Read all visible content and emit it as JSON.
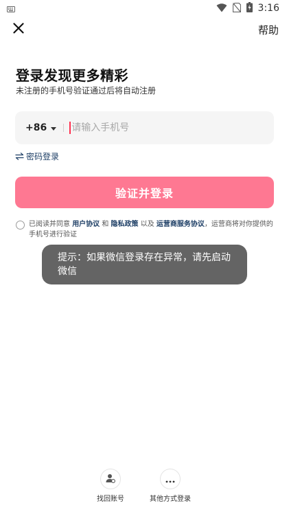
{
  "status_bar": {
    "time": "3:16",
    "icons": [
      "keyboard-icon",
      "wifi-icon",
      "no-sim-icon",
      "battery-charging-icon"
    ]
  },
  "top_bar": {
    "close_icon": "close-icon",
    "help_label": "帮助"
  },
  "title": "登录发现更多精彩",
  "subtitle": "未注册的手机号验证通过后将自动注册",
  "phone": {
    "country_code": "+86",
    "placeholder": "请输入手机号",
    "value": ""
  },
  "password_login": {
    "icon": "swap-arrows-icon",
    "label": "密码登录"
  },
  "verify_button": "验证并登录",
  "agreement": {
    "prefix": "已阅读并同意 ",
    "user_agreement": "用户协议",
    "and1": " 和 ",
    "privacy_policy": "隐私政策",
    "and2": " 以及 ",
    "carrier_agreement": "运营商服务协议",
    "suffix": "，运营商将对你提供的手机号进行验证"
  },
  "toast": "提示：如果微信登录存在异常，请先启动微信",
  "bottom_actions": [
    {
      "icon": "user-recover-icon",
      "label": "找回账号"
    },
    {
      "icon": "more-dots-icon",
      "label": "其他方式登录"
    }
  ],
  "colors": {
    "primary_button": "#fe7892",
    "link": "#1e3f66",
    "cursor": "#ff2e4d",
    "toast_bg": "#646464",
    "input_bg": "#f5f5f5"
  }
}
